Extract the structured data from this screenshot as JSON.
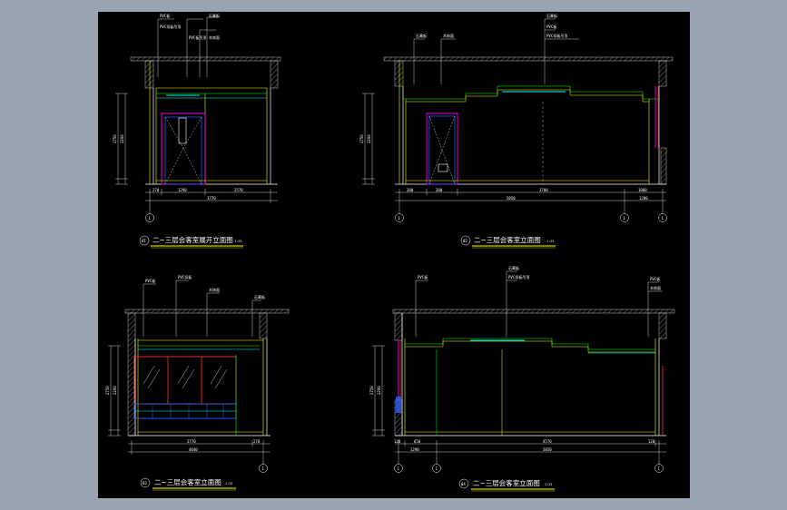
{
  "drawings": [
    {
      "id": "elev-unfold",
      "title": "二~三层会客室展开立面图",
      "scale": "1:25",
      "number": "01",
      "axis_left": "1",
      "axis_right": "",
      "dim_bottom": [
        "270",
        "1290",
        "2570"
      ],
      "dim_total": "3770",
      "dim_left": [
        "2750",
        "2200",
        "450"
      ],
      "labels": [
        "PVC板",
        "PVC扣板吊顶",
        "石膏板",
        "木饰面",
        "PVC板吊顶"
      ]
    },
    {
      "id": "elev-2",
      "title": "二~三层会客室立面图",
      "scale": "1:25",
      "number": "02",
      "axis_left": "1",
      "axis_mid": "1",
      "axis_right": "1",
      "dim_bottom": [
        "200",
        "650",
        "200",
        "3700",
        "1000"
      ],
      "dim_total": "5850",
      "dim_total_2": "1200",
      "dim_left": [
        "2750",
        "2200",
        "450"
      ],
      "labels": [
        "石膏板",
        "PVC板",
        "PVC扣板吊顶",
        "木饰面"
      ]
    },
    {
      "id": "elev-3",
      "title": "二~三层会客室立面图",
      "scale": "1:25",
      "number": "03",
      "axis_left": "",
      "axis_right": "1",
      "dim_bottom": [
        "3770",
        "270"
      ],
      "dim_total": "4040",
      "dim_left": [
        "2750",
        "2200",
        "450"
      ],
      "labels": [
        "PVC板",
        "PVC扣板",
        "木饰面",
        "石膏板"
      ]
    },
    {
      "id": "elev-4",
      "title": "二~三层会客室立面图",
      "scale": "1:25",
      "number": "04",
      "axis_left": "1",
      "axis_mid": "1",
      "axis_right": "1",
      "dim_bottom": [
        "120",
        "650",
        "4570",
        "120"
      ],
      "dim_total": "5850",
      "dim_total_2": "1290",
      "dim_left": [
        "2750",
        "2200",
        "450"
      ],
      "labels": [
        "PVC板",
        "PVC扣板吊顶",
        "石膏板",
        "木饰面"
      ]
    }
  ],
  "colors": {
    "background": "#000000",
    "frame": "#99a4b1",
    "wall": "#ffffff",
    "hatch": "#c0c0c0",
    "yellow": "#ffff00",
    "green": "#00ff00",
    "cyan": "#00ffff",
    "magenta": "#ff00ff",
    "red": "#ff3030",
    "blue": "#3060ff"
  }
}
